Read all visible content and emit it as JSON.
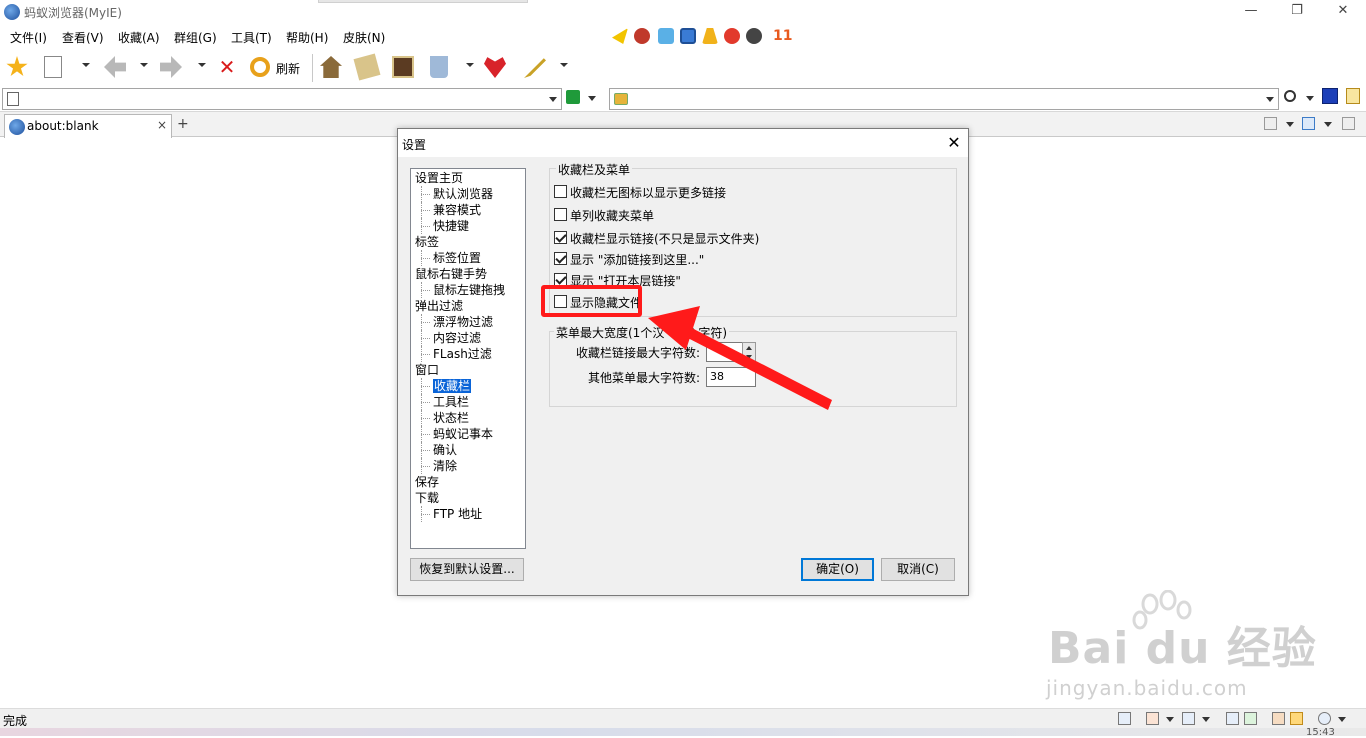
{
  "window": {
    "title": "蚂蚁浏览器(MyIE)",
    "controls": {
      "minimize": "—",
      "restore": "❐",
      "close": "✕"
    }
  },
  "menubar": [
    "文件(I)",
    "查看(V)",
    "收藏(A)",
    "群组(G)",
    "工具(T)",
    "帮助(H)",
    "皮肤(N)"
  ],
  "quick_bar": {
    "badge_count": "11"
  },
  "toolbar": {
    "refresh_label": "刷新"
  },
  "address_bar": {
    "url": "",
    "search_value": ""
  },
  "tabs": [
    {
      "label": "about:blank",
      "close": "×"
    }
  ],
  "new_tab": "+",
  "dialog": {
    "title": "设置",
    "close": "✕",
    "tree": [
      {
        "label": "设置主页",
        "level": 0
      },
      {
        "label": "默认浏览器",
        "level": 1
      },
      {
        "label": "兼容模式",
        "level": 1
      },
      {
        "label": "快捷键",
        "level": 1
      },
      {
        "label": "标签",
        "level": 0
      },
      {
        "label": "标签位置",
        "level": 1
      },
      {
        "label": "鼠标右键手势",
        "level": 0
      },
      {
        "label": "鼠标左键拖拽",
        "level": 1
      },
      {
        "label": "弹出过滤",
        "level": 0
      },
      {
        "label": "漂浮物过滤",
        "level": 1
      },
      {
        "label": "内容过滤",
        "level": 1
      },
      {
        "label": "FLash过滤",
        "level": 1
      },
      {
        "label": "窗口",
        "level": 0
      },
      {
        "label": "收藏栏",
        "level": 1,
        "selected": true
      },
      {
        "label": "工具栏",
        "level": 1
      },
      {
        "label": "状态栏",
        "level": 1
      },
      {
        "label": "蚂蚁记事本",
        "level": 1
      },
      {
        "label": "确认",
        "level": 1
      },
      {
        "label": "清除",
        "level": 1
      },
      {
        "label": "保存",
        "level": 0
      },
      {
        "label": "下载",
        "level": 0
      },
      {
        "label": "FTP 地址",
        "level": 1
      }
    ],
    "group1": {
      "label": "收藏栏及菜单",
      "options": [
        {
          "label": "收藏栏无图标以显示更多链接",
          "checked": false
        },
        {
          "label": "单列收藏夹菜单",
          "checked": false
        },
        {
          "label": "收藏栏显示链接(不只是显示文件夹)",
          "checked": true
        },
        {
          "label": "显示 \"添加链接到这里...\"",
          "checked": true
        },
        {
          "label": "显示 \"打开本层链接\"",
          "checked": true
        },
        {
          "label": "显示隐藏文件",
          "checked": false
        }
      ]
    },
    "group2": {
      "label": "菜单最大宽度(1个汉",
      "label_tail": "个字符)",
      "fav_max_label": "收藏栏链接最大字符数:",
      "fav_max_value": "",
      "other_max_label": "其他菜单最大字符数:",
      "other_max_value": "38"
    },
    "buttons": {
      "reset": "恢复到默认设置...",
      "ok": "确定(O)",
      "cancel": "取消(C)"
    }
  },
  "statusbar": {
    "text": "完成",
    "clock": "15:43"
  },
  "watermark": {
    "brand": "Bai du 经验",
    "url": "jingyan.baidu.com"
  },
  "colors": {
    "highlight": "#ff1a1a",
    "selection": "#0a64d8",
    "badge": "#e85a1f"
  }
}
